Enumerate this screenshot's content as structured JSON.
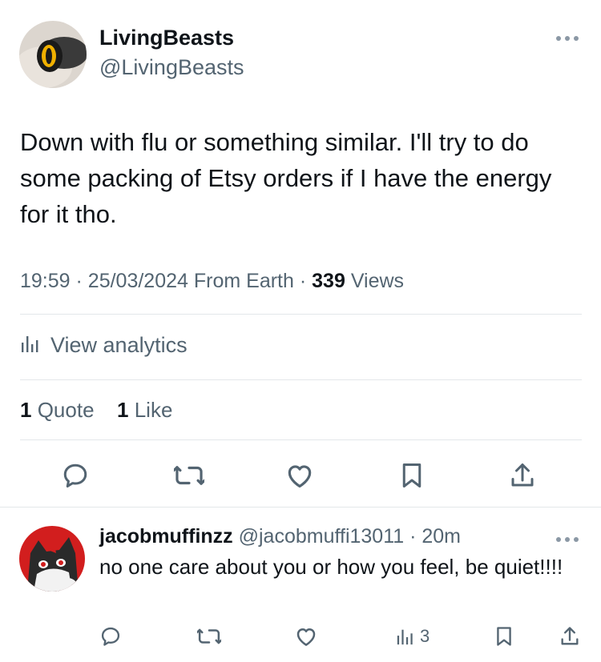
{
  "tweet": {
    "author_name": "LivingBeasts",
    "author_handle": "@LivingBeasts",
    "text": "Down with flu or something similar. I'll try to do some packing of Etsy orders if I have the energy for it tho.",
    "time": "19:59",
    "date": "25/03/2024",
    "source": "From Earth",
    "view_count": "339",
    "views_label": "Views",
    "analytics_label": "View analytics",
    "quote_count": "1",
    "quote_label": "Quote",
    "like_count": "1",
    "like_label": "Like",
    "icons": [
      "more-icon",
      "reply-icon",
      "retweet-icon",
      "like-icon",
      "bookmark-icon",
      "share-icon",
      "analytics-icon"
    ]
  },
  "reply": {
    "author_name": "jacobmuffinzz",
    "author_handle": "@jacobmuffi13011",
    "time": "20m",
    "text": "no one care about you or how you feel, be quiet!!!!",
    "view_count": "3"
  },
  "colors": {
    "text_primary": "#0f1419",
    "text_secondary": "#536471",
    "divider": "#e3e7ea"
  }
}
